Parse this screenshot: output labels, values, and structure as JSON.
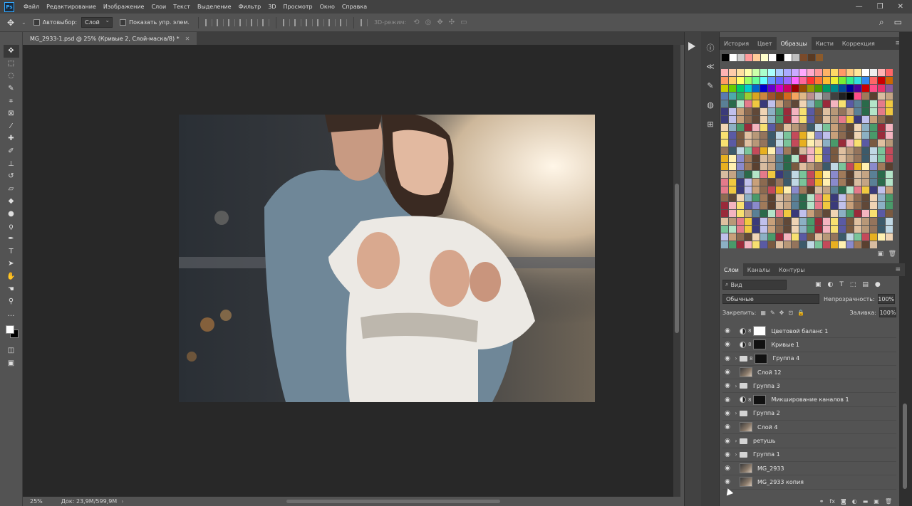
{
  "menu": [
    "Файл",
    "Редактирование",
    "Изображение",
    "Слои",
    "Текст",
    "Выделение",
    "Фильтр",
    "3D",
    "Просмотр",
    "Окно",
    "Справка"
  ],
  "window_controls": [
    "—",
    "❐",
    "✕"
  ],
  "options": {
    "autoselect_label": "Автовыбор:",
    "autoselect_value": "Слой",
    "show_transform_label": "Показать упр. элем.",
    "mode_3d_label": "3D-режим:"
  },
  "document": {
    "tab_title": "MG_2933-1.psd @ 25% (Кривые 2, Слой-маска/8) *",
    "zoom": "25%",
    "doc_info": "Док: 23,9M/599,9M"
  },
  "swatch_tabs": [
    "История",
    "Цвет",
    "Образцы",
    "Кисти",
    "Коррекция"
  ],
  "swatch_active": "Образцы",
  "recent_swatches": [
    "#000000",
    "#ffffff",
    "#cccccc",
    "#ff9a9a",
    "#ffcc99",
    "#ffffcc",
    "#ffffff",
    "#000000",
    "#ffffff",
    "#bfbfbf",
    "#7a4a2a",
    "#5a3a22",
    "#8b5a2b"
  ],
  "layer_tabs": [
    "Слои",
    "Каналы",
    "Контуры"
  ],
  "layers_panel": {
    "search_placeholder": "Вид",
    "blend_mode": "Обычные",
    "opacity_label": "Непрозрачность:",
    "opacity_value": "100%",
    "lock_label": "Закрепить:",
    "fill_label": "Заливка:",
    "fill_value": "100%",
    "layers": [
      {
        "name": "Цветовой баланс 1",
        "kind": "adjustment",
        "mask": "#ffffff"
      },
      {
        "name": "Кривые 1",
        "kind": "adjustment",
        "mask": "#111111"
      },
      {
        "name": "Группа 4",
        "kind": "group-mask"
      },
      {
        "name": "Слой 12",
        "kind": "pixel"
      },
      {
        "name": "Группа 3",
        "kind": "group"
      },
      {
        "name": "Микширование каналов 1",
        "kind": "adjustment",
        "mask": "#111111"
      },
      {
        "name": "Группа 2",
        "kind": "group"
      },
      {
        "name": "Слой 4",
        "kind": "pixel"
      },
      {
        "name": "ретушь",
        "kind": "group"
      },
      {
        "name": "Группа 1",
        "kind": "group"
      },
      {
        "name": "MG_2933",
        "kind": "pixel"
      },
      {
        "name": "MG_2933 копия",
        "kind": "pixel"
      }
    ]
  },
  "tools": [
    "move-tool",
    "marquee-tool",
    "lasso-tool",
    "quick-select-tool",
    "crop-tool",
    "frame-tool",
    "eyedropper-tool",
    "healing-brush-tool",
    "brush-tool",
    "clone-stamp-tool",
    "history-brush-tool",
    "eraser-tool",
    "gradient-tool",
    "blur-tool",
    "dodge-tool",
    "pen-tool",
    "type-tool",
    "path-select-tool",
    "shape-tool",
    "hand-tool",
    "zoom-tool"
  ],
  "colors": {
    "foreground": "#ffffff",
    "background": "#000000"
  }
}
